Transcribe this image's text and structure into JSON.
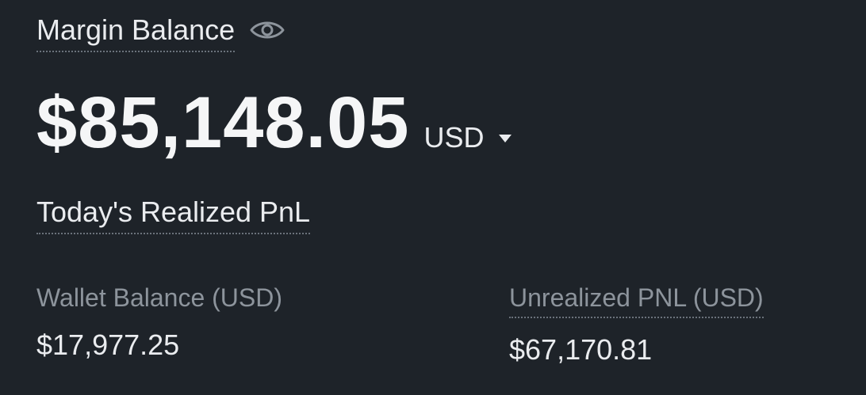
{
  "margin": {
    "label": "Margin Balance",
    "value": "$85,148.05",
    "currency": "USD"
  },
  "realized_pnl": {
    "label": "Today's Realized PnL"
  },
  "wallet": {
    "label": "Wallet Balance (USD)",
    "value": "$17,977.25"
  },
  "unrealized": {
    "label": "Unrealized PNL (USD)",
    "value": "$67,170.81"
  },
  "icons": {
    "visibility": "eye-icon",
    "dropdown": "caret-down-icon"
  },
  "colors": {
    "background": "#1e2329",
    "primary_text": "#eaecef",
    "secondary_text": "#8d949c"
  }
}
